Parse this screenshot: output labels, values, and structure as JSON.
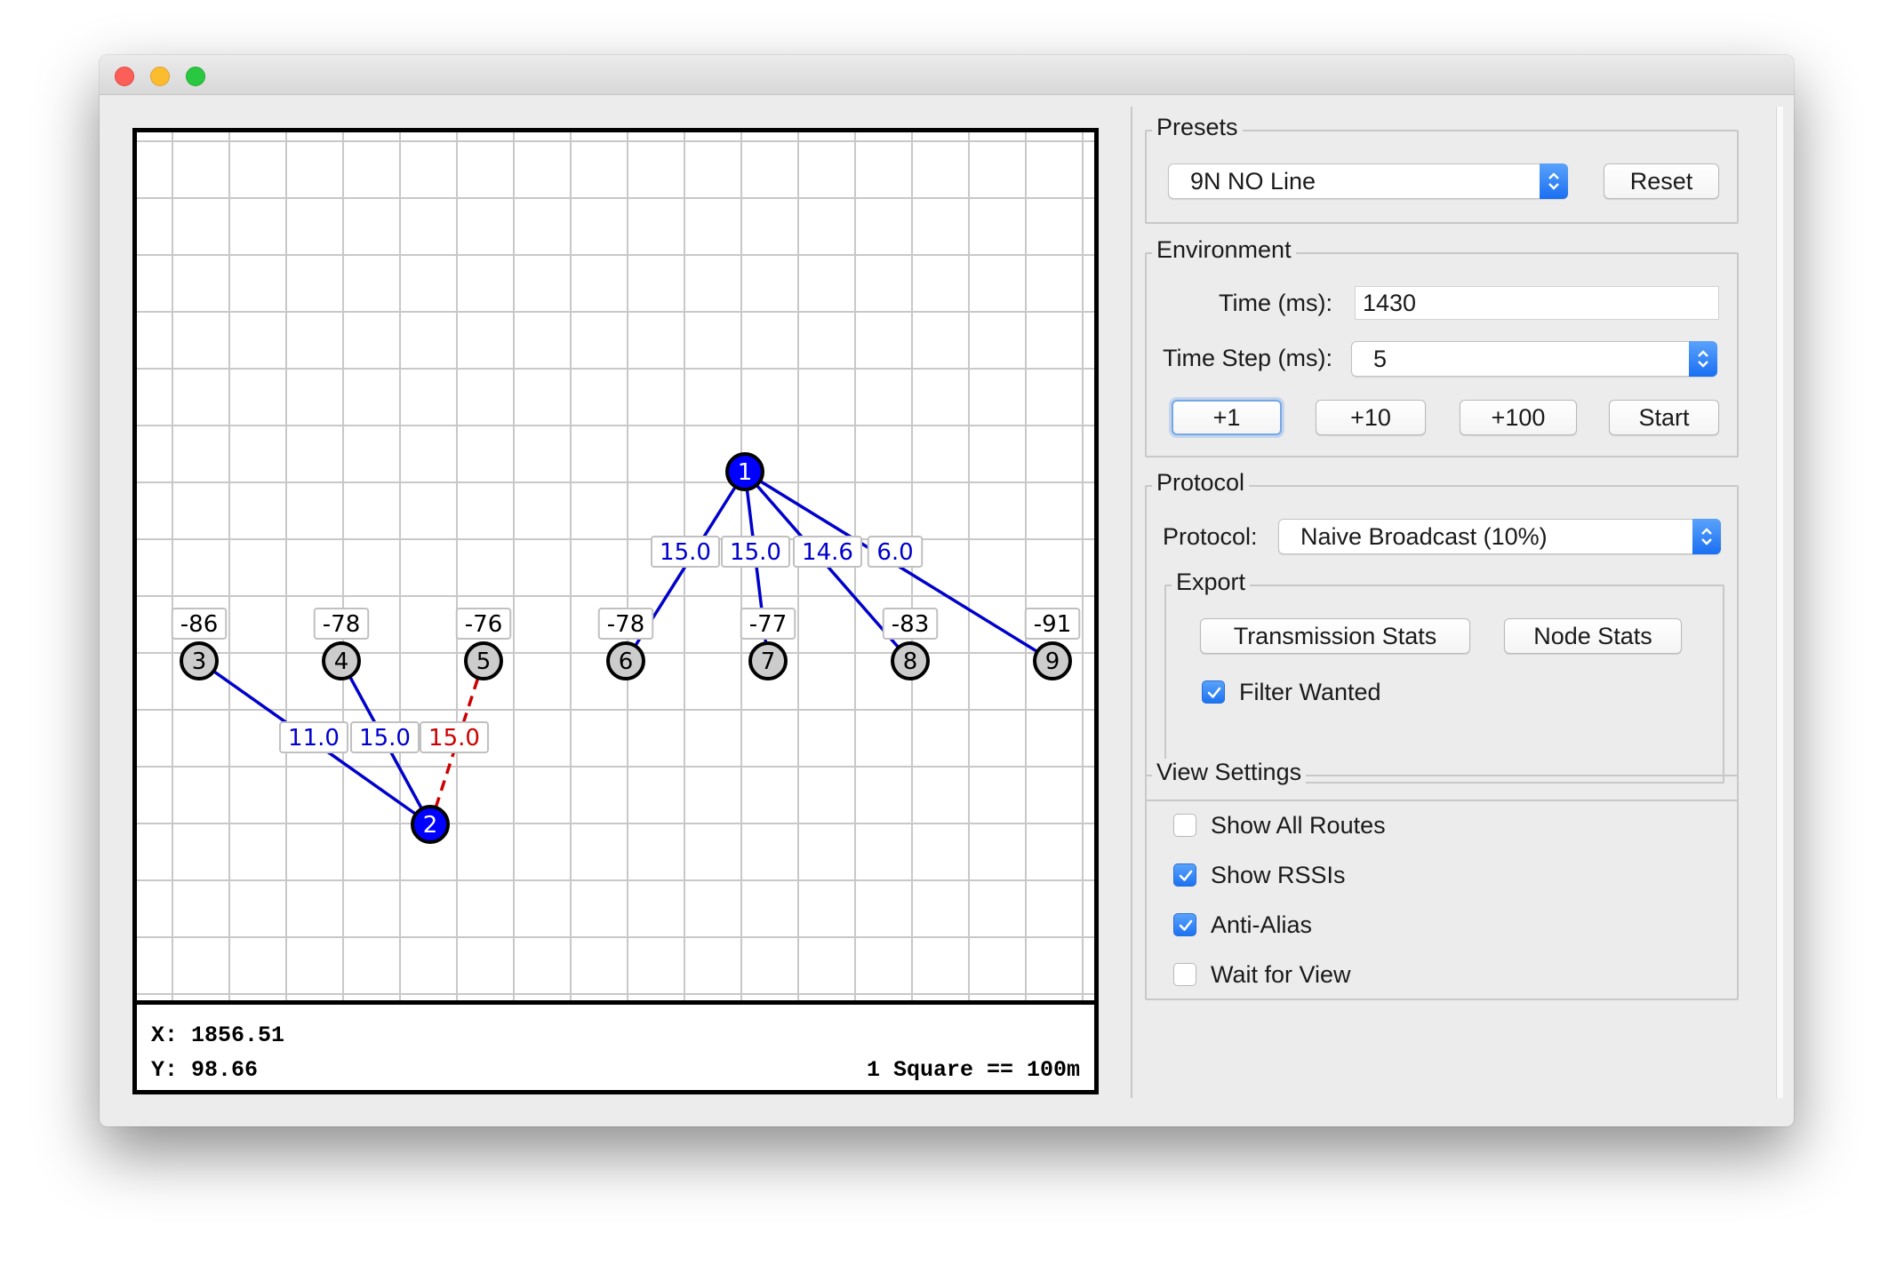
{
  "coords": {
    "x": "X: 1856.51",
    "y": "Y: 98.66",
    "scale": "1 Square == 100m"
  },
  "nodes": [
    {
      "id": "1",
      "rssi": null,
      "color": "#0000ff"
    },
    {
      "id": "2",
      "rssi": null,
      "color": "#0000ff"
    },
    {
      "id": "3",
      "rssi": "-86",
      "color": "#cccccc"
    },
    {
      "id": "4",
      "rssi": "-78",
      "color": "#cccccc"
    },
    {
      "id": "5",
      "rssi": "-76",
      "color": "#cccccc"
    },
    {
      "id": "6",
      "rssi": "-78",
      "color": "#cccccc"
    },
    {
      "id": "7",
      "rssi": "-77",
      "color": "#cccccc"
    },
    {
      "id": "8",
      "rssi": "-83",
      "color": "#cccccc"
    },
    {
      "id": "9",
      "rssi": "-91",
      "color": "#cccccc"
    }
  ],
  "links": [
    {
      "from": "1",
      "to": "6",
      "label": "15.0",
      "style": "solid",
      "color": "#0000cc"
    },
    {
      "from": "1",
      "to": "7",
      "label": "15.0",
      "style": "solid",
      "color": "#0000cc"
    },
    {
      "from": "1",
      "to": "8",
      "label": "14.6",
      "style": "solid",
      "color": "#0000cc"
    },
    {
      "from": "1",
      "to": "9",
      "label": "6.0",
      "style": "solid",
      "color": "#0000cc"
    },
    {
      "from": "2",
      "to": "3",
      "label": "11.0",
      "style": "solid",
      "color": "#0000cc"
    },
    {
      "from": "2",
      "to": "4",
      "label": "15.0",
      "style": "solid",
      "color": "#0000cc"
    },
    {
      "from": "2",
      "to": "5",
      "label": "15.0",
      "style": "dashed",
      "color": "#cc0000"
    }
  ],
  "presets": {
    "title": "Presets",
    "selected": "9N NO Line",
    "reset": "Reset"
  },
  "environment": {
    "title": "Environment",
    "time_label": "Time (ms):",
    "time_value": "1430",
    "step_label": "Time Step (ms):",
    "step_value": "5",
    "buttons": [
      "+1",
      "+10",
      "+100",
      "Start"
    ]
  },
  "protocol": {
    "title": "Protocol",
    "label": "Protocol:",
    "selected": "Naive Broadcast (10%)",
    "export": {
      "title": "Export",
      "transmission_stats": "Transmission Stats",
      "node_stats": "Node Stats",
      "filter_wanted": {
        "label": "Filter Wanted",
        "checked": true
      }
    }
  },
  "view_settings": {
    "title": "View Settings",
    "options": [
      {
        "label": "Show All Routes",
        "checked": false
      },
      {
        "label": "Show RSSIs",
        "checked": true
      },
      {
        "label": "Anti-Alias",
        "checked": true
      },
      {
        "label": "Wait for View",
        "checked": false
      }
    ]
  },
  "colors": {
    "accent": "#1c72f2",
    "node_active": "#0000ff",
    "node_idle": "#cccccc",
    "link": "#0000cc",
    "link_dropped": "#cc0000"
  }
}
